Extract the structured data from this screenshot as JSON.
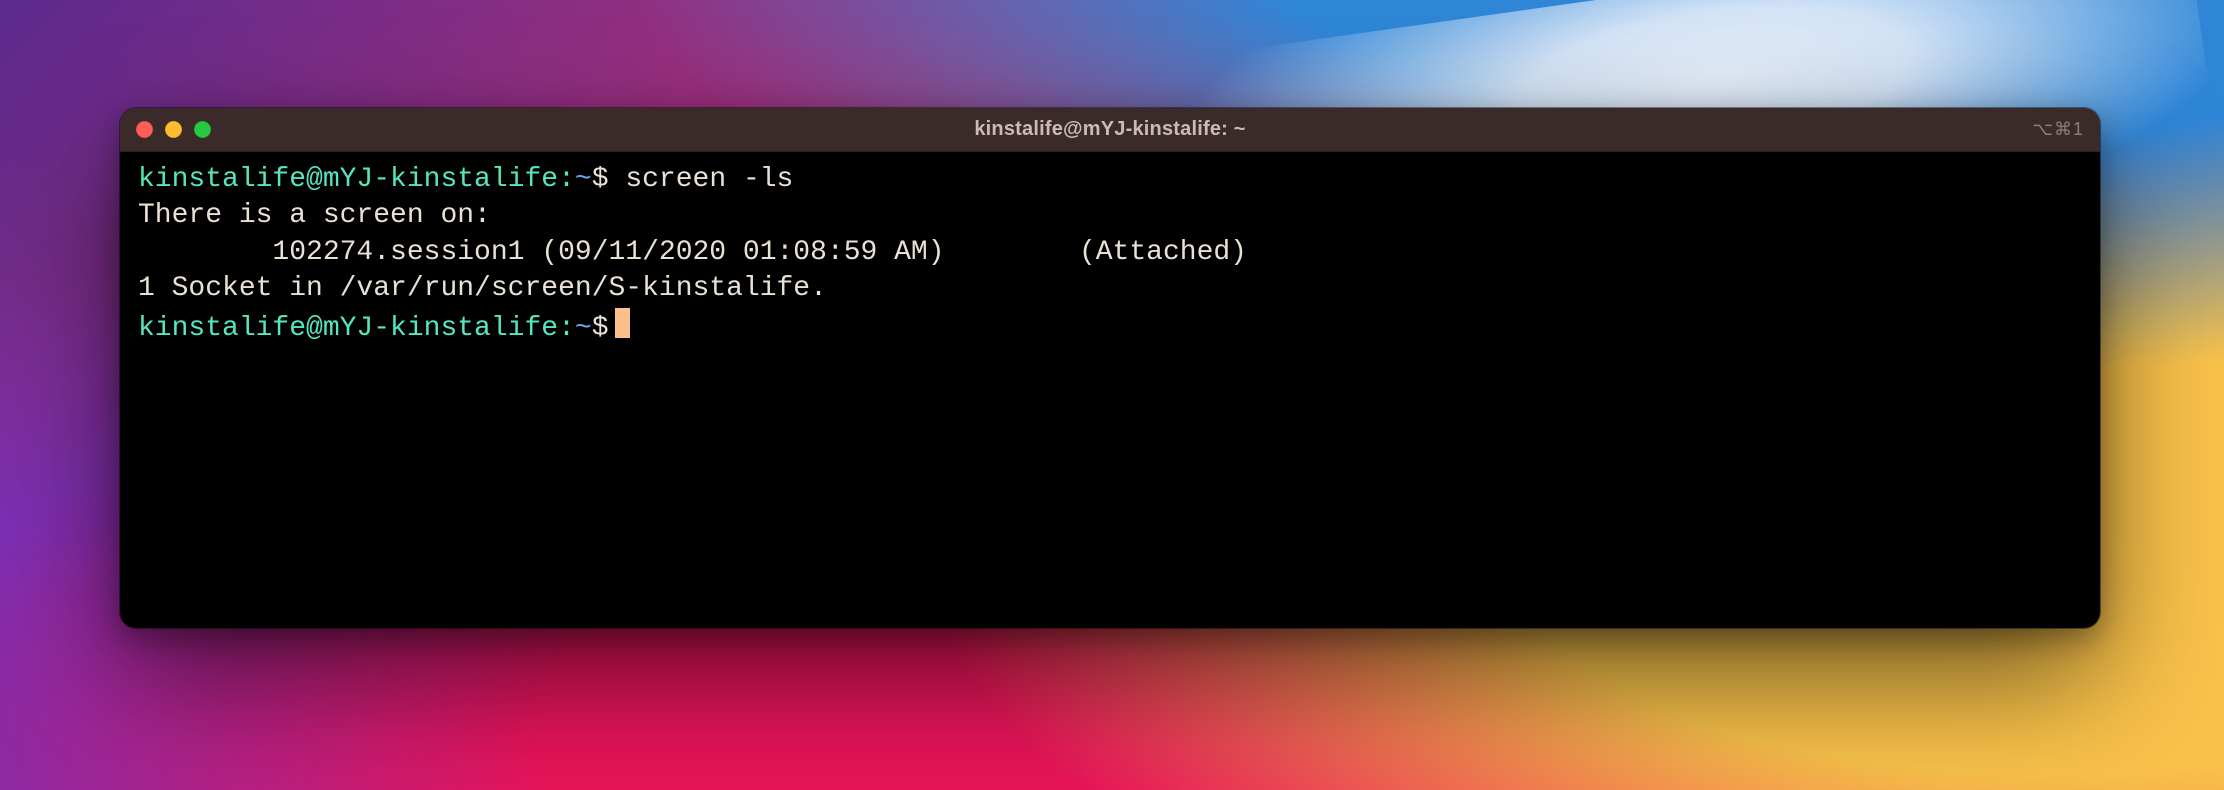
{
  "window": {
    "title": "kinstalife@mYJ-kinstalife: ~",
    "shortcut_hint": "⌥⌘1"
  },
  "prompt": {
    "user_host": "kinstalife@mYJ-kinstalife",
    "sep": ":",
    "path": "~",
    "symbol": "$"
  },
  "command": "screen -ls",
  "output": {
    "line1": "There is a screen on:",
    "line2": "        102274.session1 (09/11/2020 01:08:59 AM)        (Attached)",
    "line3": "1 Socket in /var/run/screen/S-kinstalife."
  }
}
